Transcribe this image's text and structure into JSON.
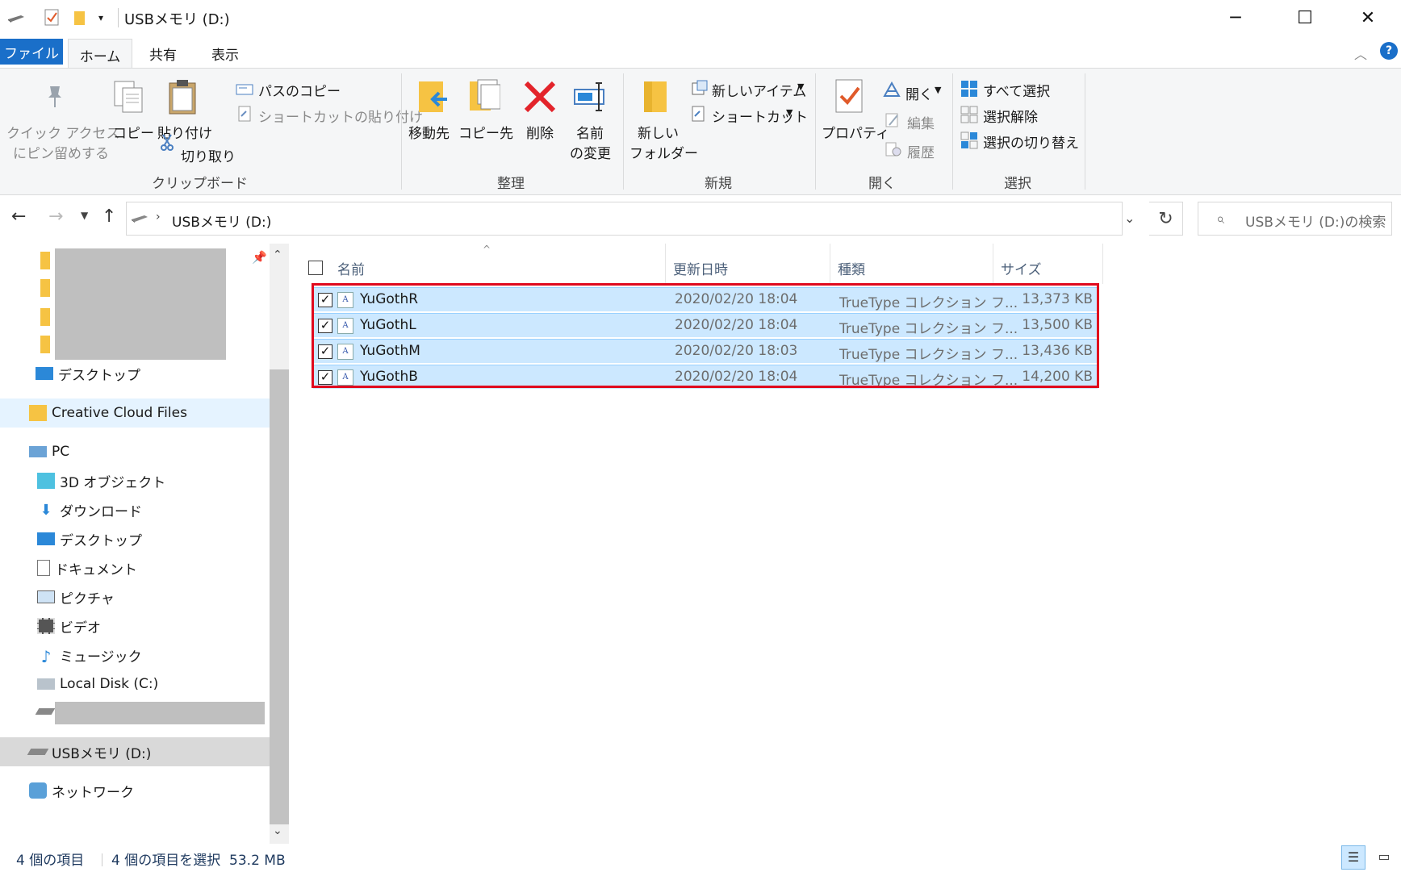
{
  "window": {
    "title": "USBメモリ (D:)",
    "minimize": "─",
    "maximize": "☐",
    "close": "✕"
  },
  "tabs": {
    "file": "ファイル",
    "home": "ホーム",
    "share": "共有",
    "view": "表示"
  },
  "ribbon": {
    "clipboard": {
      "pin_line1": "クイック アクセス",
      "pin_line2": "にピン留めする",
      "copy": "コピー",
      "paste": "貼り付け",
      "copy_path": "パスのコピー",
      "paste_shortcut": "ショートカットの貼り付け",
      "cut": "切り取り",
      "group": "クリップボード"
    },
    "organize": {
      "move_to": "移動先",
      "copy_to": "コピー先",
      "delete": "削除",
      "rename_line1": "名前",
      "rename_line2": "の変更",
      "group": "整理"
    },
    "new": {
      "new_folder_line1": "新しい",
      "new_folder_line2": "フォルダー",
      "new_item": "新しいアイテム",
      "shortcut": "ショートカット",
      "group": "新規"
    },
    "open": {
      "properties": "プロパティ",
      "open": "開く",
      "edit": "編集",
      "history": "履歴",
      "group": "開く"
    },
    "select": {
      "select_all": "すべて選択",
      "select_none": "選択解除",
      "invert": "選択の切り替え",
      "group": "選択"
    }
  },
  "address": {
    "path": "USBメモリ (D:)",
    "search_placeholder": "USBメモリ (D:)の検索"
  },
  "nav": {
    "desktop_quick": "デスクトップ",
    "creative_cloud": "Creative Cloud Files",
    "pc": "PC",
    "objects3d": "3D オブジェクト",
    "downloads": "ダウンロード",
    "desktop": "デスクトップ",
    "documents": "ドキュメント",
    "pictures": "ピクチャ",
    "videos": "ビデオ",
    "music": "ミュージック",
    "local_disk": "Local Disk (C:)",
    "usb": "USBメモリ (D:)",
    "network": "ネットワーク"
  },
  "columns": {
    "name": "名前",
    "modified": "更新日時",
    "type": "種類",
    "size": "サイズ"
  },
  "files": [
    {
      "name": "YuGothR",
      "modified": "2020/02/20 18:04",
      "type": "TrueType コレクション フ...",
      "size": "13,373 KB"
    },
    {
      "name": "YuGothL",
      "modified": "2020/02/20 18:04",
      "type": "TrueType コレクション フ...",
      "size": "13,500 KB"
    },
    {
      "name": "YuGothM",
      "modified": "2020/02/20 18:03",
      "type": "TrueType コレクション フ...",
      "size": "13,436 KB"
    },
    {
      "name": "YuGothB",
      "modified": "2020/02/20 18:04",
      "type": "TrueType コレクション フ...",
      "size": "14,200 KB"
    }
  ],
  "status": {
    "item_count": "4 個の項目",
    "selected": "4 個の項目を選択  53.2 MB"
  },
  "colors": {
    "accent": "#1a6fc9",
    "selection": "#cce8ff",
    "highlight_border": "#e00a1e"
  }
}
